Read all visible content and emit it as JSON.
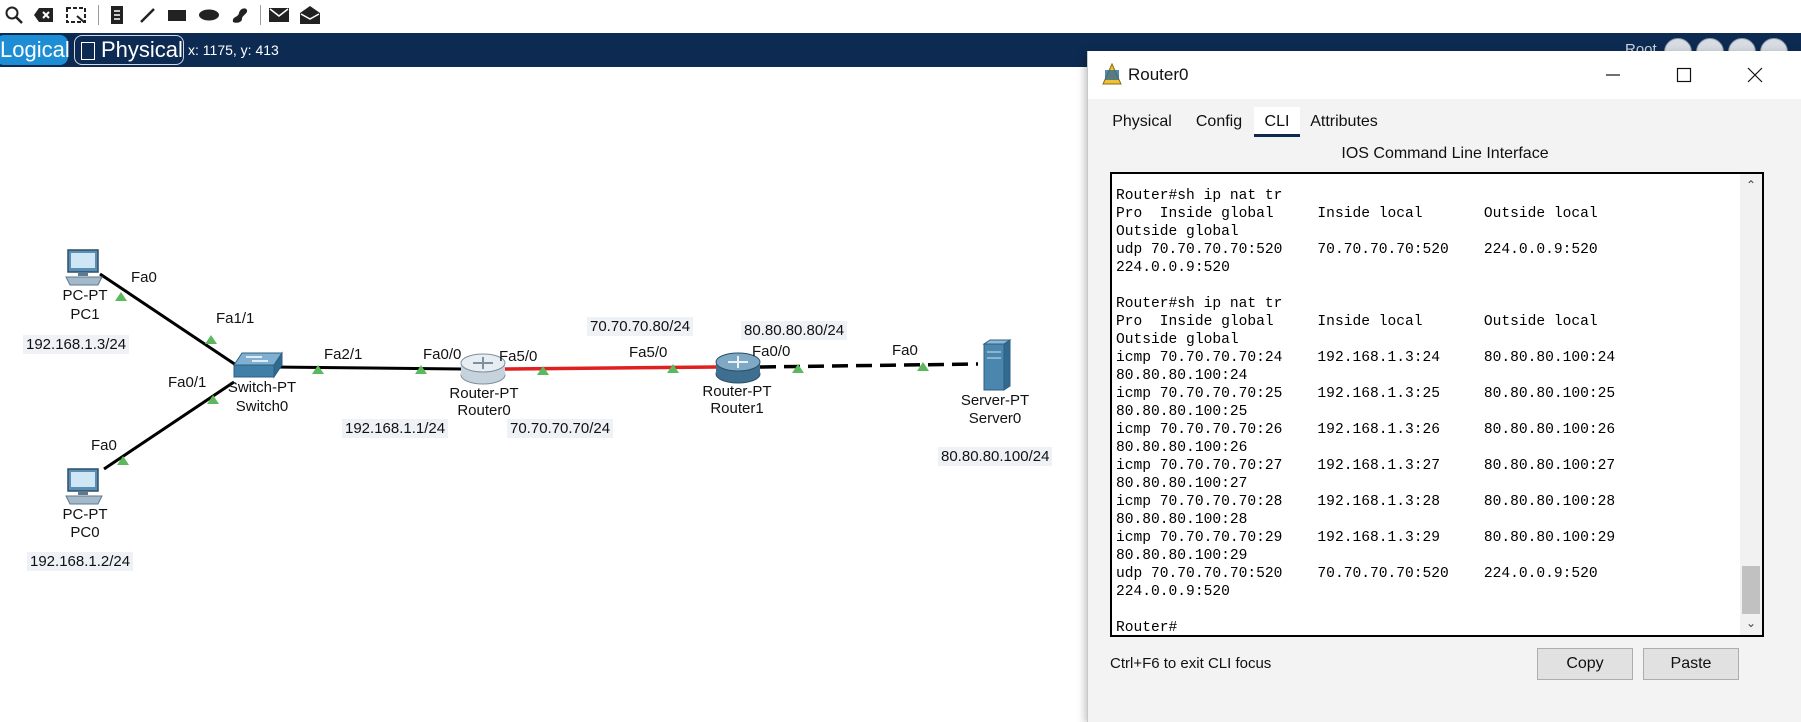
{
  "toolbar": {
    "icons": [
      "search-icon",
      "delete-icon",
      "resize-shape-icon",
      "note-icon",
      "draw-line-icon",
      "rectangle-icon",
      "ellipse-icon",
      "freeform-icon",
      "simple-pdu-icon",
      "complex-pdu-icon"
    ]
  },
  "modebar": {
    "logical_label": "Logical",
    "physical_label": "Physical",
    "coords": "x: 1175, y: 413",
    "root_label": "Root"
  },
  "topology": {
    "pc1": {
      "type": "PC-PT",
      "name": "PC1",
      "port": "Fa0",
      "ip": "192.168.1.3/24"
    },
    "pc0": {
      "type": "PC-PT",
      "name": "PC0",
      "port": "Fa0",
      "ip": "192.168.1.2/24"
    },
    "switch0": {
      "type": "Switch-PT",
      "name": "Switch0",
      "port_pc1": "Fa1/1",
      "port_pc0": "Fa0/1",
      "port_router": "Fa2/1"
    },
    "router0": {
      "type": "Router-PT",
      "name": "Router0",
      "port_lan": "Fa0/0",
      "port_wan": "Fa5/0",
      "ip_lan": "192.168.1.1/24",
      "ip_wan": "70.70.70.70/24"
    },
    "router1": {
      "type": "Router-PT",
      "name": "Router1",
      "port_wan": "Fa5/0",
      "port_lan": "Fa0/0",
      "ip_wan": "70.70.70.80/24",
      "ip_lan": "80.80.80.80/24"
    },
    "server0": {
      "type": "Server-PT",
      "name": "Server0",
      "port": "Fa0",
      "ip": "80.80.80.100/24"
    },
    "colors": {
      "link": "#000000",
      "red_link": "#e02020",
      "port_up": "#5cb85c"
    }
  },
  "window": {
    "title": "Router0",
    "tabs": [
      {
        "label": "Physical",
        "active": false
      },
      {
        "label": "Config",
        "active": false
      },
      {
        "label": "CLI",
        "active": true
      },
      {
        "label": "Attributes",
        "active": false
      }
    ],
    "cli_heading": "IOS Command Line Interface",
    "cli_output": "Router#sh ip nat tr\nPro  Inside global     Inside local       Outside local\nOutside global\nudp 70.70.70.70:520    70.70.70.70:520    224.0.0.9:520\n224.0.0.9:520\n\nRouter#sh ip nat tr\nPro  Inside global     Inside local       Outside local\nOutside global\nicmp 70.70.70.70:24    192.168.1.3:24     80.80.80.100:24\n80.80.80.100:24\nicmp 70.70.70.70:25    192.168.1.3:25     80.80.80.100:25\n80.80.80.100:25\nicmp 70.70.70.70:26    192.168.1.3:26     80.80.80.100:26\n80.80.80.100:26\nicmp 70.70.70.70:27    192.168.1.3:27     80.80.80.100:27\n80.80.80.100:27\nicmp 70.70.70.70:28    192.168.1.3:28     80.80.80.100:28\n80.80.80.100:28\nicmp 70.70.70.70:29    192.168.1.3:29     80.80.80.100:29\n80.80.80.100:29\nudp 70.70.70.70:520    70.70.70.70:520    224.0.0.9:520\n224.0.0.9:520\n\nRouter#",
    "hint": "Ctrl+F6 to exit CLI focus",
    "copy_label": "Copy",
    "paste_label": "Paste"
  }
}
